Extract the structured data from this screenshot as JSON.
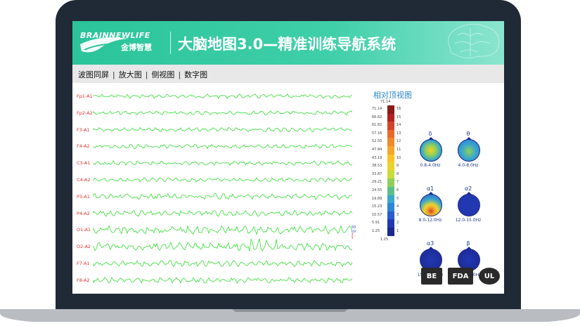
{
  "header": {
    "logo_top": "BRAINNEWLIFE",
    "logo_bottom": "金博智慧",
    "title": "大脑地图3.0—精准训练导航系统"
  },
  "menu": {
    "items": [
      "波图同屏",
      "放大图",
      "侧视图",
      "数字图"
    ],
    "separator": "|"
  },
  "eeg": {
    "channels": [
      "Fp1-A1",
      "Fp2-A2",
      "F3-A1",
      "F4-A2",
      "C3-A1",
      "C4-A2",
      "P3-A1",
      "P4-A2",
      "O1-A1",
      "O2-A2",
      "F7-A1",
      "F8-A2"
    ],
    "scale_value": "50",
    "scale_unit": "uV",
    "wave_color": "#33dd33"
  },
  "topo_panel": {
    "title": "相对顶视图",
    "scale_top": "71.14",
    "scale_bottom": "1.25",
    "scale_values": [
      "71.14",
      "66.62",
      "61.82",
      "57.16",
      "52.50",
      "47.84",
      "43.19",
      "38.53",
      "33.87",
      "29.21",
      "24.55",
      "19.89",
      "15.23",
      "10.57",
      "5.91",
      "1.25"
    ],
    "scale_indices": [
      "16",
      "15",
      "14",
      "13",
      "12",
      "11",
      "10",
      "9",
      "8",
      "7",
      "6",
      "5",
      "4",
      "3",
      "2",
      "1"
    ],
    "bands": [
      {
        "greek": "δ",
        "range": "0.8-4.0Hz"
      },
      {
        "greek": "θ",
        "range": "4.0-8.0Hz"
      },
      {
        "greek": "α1",
        "range": "8.0-12.0Hz"
      },
      {
        "greek": "α2",
        "range": "12.0-15.0Hz"
      },
      {
        "greek": "α3",
        "range": "15.0-20.0Hz"
      },
      {
        "greek": "β",
        "range": "20.0-30.0Hz"
      }
    ]
  },
  "certifications": [
    "BE",
    "FDA",
    "UL"
  ]
}
